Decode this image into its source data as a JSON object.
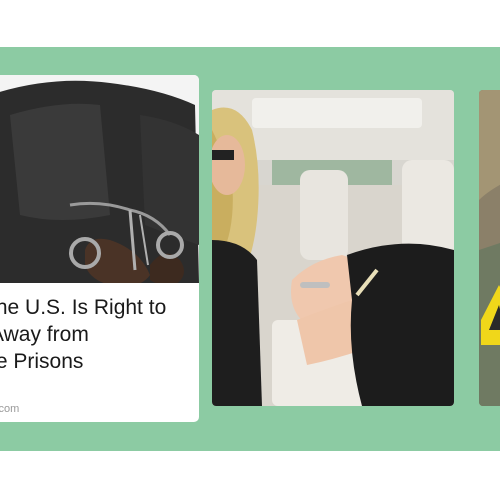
{
  "feed": {
    "article": {
      "title": "the U.S. Is Right to\nAway from\nte Prisons",
      "source": "k.com",
      "image_icon": "handcuffed-hands-photo"
    },
    "video": {
      "image_icon": "car-interior-video-thumbnail"
    },
    "partial": {
      "image_icon": "yellow-sign-thumbnail"
    },
    "colors": {
      "background_band": "#8ccba3",
      "card_background": "#ffffff",
      "title_text": "#1a1a1a",
      "source_text": "#9a9a9a"
    }
  }
}
